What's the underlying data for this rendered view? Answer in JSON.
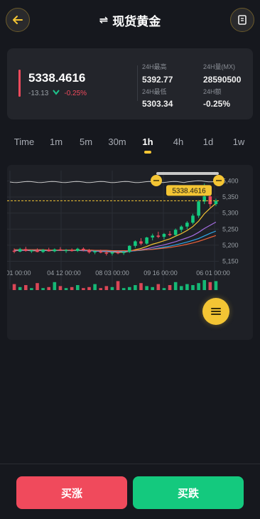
{
  "header": {
    "title": "现货黄金",
    "swap_symbol": "⇌"
  },
  "ticker": {
    "last_price": "5338.4616",
    "change": "-13.13",
    "change_pct": "-0.25%",
    "stats": [
      {
        "label": "24H最高",
        "value": "5392.77"
      },
      {
        "label": "24H量(MX)",
        "value": "28590500"
      },
      {
        "label": "24H最低",
        "value": "5303.34"
      },
      {
        "label": "24H额",
        "value": "-0.25%"
      }
    ]
  },
  "timeframes": [
    "Time",
    "1m",
    "5m",
    "30m",
    "1h",
    "4h",
    "1d",
    "1w"
  ],
  "active_timeframe": "1h",
  "chart_data": {
    "type": "candlestick",
    "price_label": "5338.4616",
    "y_ticks": [
      "5,400",
      "5,350",
      "5,300",
      "5,250",
      "5,200",
      "5,150"
    ],
    "y_tick_values": [
      5400,
      5350,
      5300,
      5250,
      5200,
      5150
    ],
    "ylim": [
      5140,
      5410
    ],
    "x_ticks": [
      "01 00:00",
      "04 12 00:00",
      "08 03 00:00",
      "09 16 00:00",
      "06 01 00:00"
    ],
    "current_price": 5338.4616,
    "candles": [
      {
        "o": 5183,
        "h": 5190,
        "l": 5175,
        "c": 5180
      },
      {
        "o": 5180,
        "h": 5192,
        "l": 5178,
        "c": 5188
      },
      {
        "o": 5188,
        "h": 5195,
        "l": 5180,
        "c": 5182
      },
      {
        "o": 5182,
        "h": 5186,
        "l": 5176,
        "c": 5184
      },
      {
        "o": 5184,
        "h": 5190,
        "l": 5178,
        "c": 5179
      },
      {
        "o": 5179,
        "h": 5188,
        "l": 5176,
        "c": 5186
      },
      {
        "o": 5186,
        "h": 5192,
        "l": 5180,
        "c": 5181
      },
      {
        "o": 5181,
        "h": 5190,
        "l": 5178,
        "c": 5187
      },
      {
        "o": 5187,
        "h": 5194,
        "l": 5182,
        "c": 5183
      },
      {
        "o": 5183,
        "h": 5188,
        "l": 5176,
        "c": 5185
      },
      {
        "o": 5185,
        "h": 5190,
        "l": 5180,
        "c": 5182
      },
      {
        "o": 5182,
        "h": 5192,
        "l": 5179,
        "c": 5189
      },
      {
        "o": 5189,
        "h": 5193,
        "l": 5181,
        "c": 5184
      },
      {
        "o": 5184,
        "h": 5188,
        "l": 5174,
        "c": 5178
      },
      {
        "o": 5178,
        "h": 5184,
        "l": 5172,
        "c": 5181
      },
      {
        "o": 5181,
        "h": 5186,
        "l": 5175,
        "c": 5177
      },
      {
        "o": 5177,
        "h": 5182,
        "l": 5168,
        "c": 5174
      },
      {
        "o": 5174,
        "h": 5180,
        "l": 5168,
        "c": 5178
      },
      {
        "o": 5178,
        "h": 5184,
        "l": 5172,
        "c": 5176
      },
      {
        "o": 5176,
        "h": 5181,
        "l": 5170,
        "c": 5179
      },
      {
        "o": 5179,
        "h": 5200,
        "l": 5176,
        "c": 5198
      },
      {
        "o": 5198,
        "h": 5215,
        "l": 5192,
        "c": 5212
      },
      {
        "o": 5212,
        "h": 5222,
        "l": 5200,
        "c": 5205
      },
      {
        "o": 5205,
        "h": 5226,
        "l": 5202,
        "c": 5224
      },
      {
        "o": 5224,
        "h": 5236,
        "l": 5215,
        "c": 5230
      },
      {
        "o": 5230,
        "h": 5242,
        "l": 5222,
        "c": 5226
      },
      {
        "o": 5226,
        "h": 5238,
        "l": 5218,
        "c": 5235
      },
      {
        "o": 5235,
        "h": 5244,
        "l": 5228,
        "c": 5232
      },
      {
        "o": 5232,
        "h": 5252,
        "l": 5228,
        "c": 5248
      },
      {
        "o": 5248,
        "h": 5262,
        "l": 5240,
        "c": 5258
      },
      {
        "o": 5258,
        "h": 5275,
        "l": 5250,
        "c": 5270
      },
      {
        "o": 5270,
        "h": 5298,
        "l": 5265,
        "c": 5292
      },
      {
        "o": 5292,
        "h": 5340,
        "l": 5285,
        "c": 5336
      },
      {
        "o": 5336,
        "h": 5392,
        "l": 5328,
        "c": 5352
      },
      {
        "o": 5352,
        "h": 5360,
        "l": 5318,
        "c": 5328
      },
      {
        "o": 5328,
        "h": 5345,
        "l": 5322,
        "c": 5338
      }
    ],
    "ma_series": [
      {
        "color": "#f4c534",
        "values": [
          5183,
          5184,
          5184,
          5183,
          5183,
          5184,
          5183,
          5184,
          5184,
          5184,
          5184,
          5184,
          5184,
          5183,
          5182,
          5181,
          5180,
          5179,
          5178,
          5178,
          5181,
          5186,
          5190,
          5196,
          5203,
          5208,
          5214,
          5220,
          5228,
          5236,
          5246,
          5258,
          5275,
          5298,
          5315,
          5330
        ]
      },
      {
        "color": "#a56de2",
        "values": [
          5184,
          5184,
          5184,
          5184,
          5184,
          5184,
          5184,
          5184,
          5184,
          5184,
          5184,
          5184,
          5183,
          5183,
          5182,
          5181,
          5181,
          5180,
          5180,
          5180,
          5181,
          5183,
          5186,
          5189,
          5193,
          5197,
          5201,
          5206,
          5211,
          5217,
          5223,
          5230,
          5240,
          5252,
          5262,
          5272
        ]
      },
      {
        "color": "#2fa8e8",
        "values": [
          5185,
          5185,
          5185,
          5185,
          5185,
          5184,
          5184,
          5184,
          5184,
          5184,
          5184,
          5184,
          5184,
          5183,
          5183,
          5182,
          5182,
          5182,
          5181,
          5181,
          5182,
          5183,
          5184,
          5186,
          5188,
          5191,
          5194,
          5197,
          5201,
          5205,
          5210,
          5215,
          5221,
          5229,
          5237,
          5244
        ]
      },
      {
        "color": "#e8613a",
        "values": [
          5186,
          5186,
          5186,
          5186,
          5186,
          5186,
          5185,
          5185,
          5185,
          5185,
          5185,
          5185,
          5185,
          5185,
          5184,
          5184,
          5184,
          5183,
          5183,
          5183,
          5183,
          5184,
          5185,
          5186,
          5187,
          5189,
          5191,
          5193,
          5196,
          5199,
          5203,
          5207,
          5212,
          5218,
          5224,
          5230
        ]
      }
    ],
    "volumes": [
      0.6,
      0.3,
      0.5,
      0.2,
      0.7,
      0.2,
      0.3,
      0.8,
      0.4,
      0.2,
      0.3,
      0.5,
      0.2,
      0.3,
      0.6,
      0.2,
      0.4,
      0.3,
      0.9,
      0.2,
      0.3,
      0.5,
      0.7,
      0.4,
      0.3,
      0.6,
      0.2,
      0.5,
      0.8,
      0.4,
      0.6,
      0.5,
      0.7,
      1.0,
      0.8,
      0.9
    ]
  },
  "actions": {
    "buy_up": "买涨",
    "buy_down": "买跌"
  },
  "colors": {
    "accent": "#f4c534",
    "up": "#14c97e",
    "down": "#f04a5c"
  }
}
